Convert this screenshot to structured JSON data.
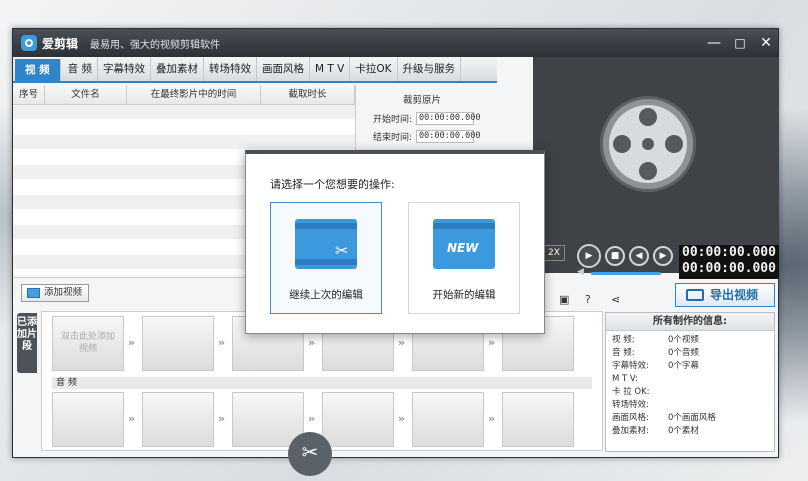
{
  "app": {
    "name": "爱剪辑",
    "slogan": "最易用、强大的视频剪辑软件"
  },
  "window_controls": {
    "minimize": "—",
    "maximize": "□",
    "close": "✕"
  },
  "tabs": [
    "视 频",
    "音 频",
    "字幕特效",
    "叠加素材",
    "转场特效",
    "画面风格",
    "M T V",
    "卡拉OK",
    "升级与服务"
  ],
  "list": {
    "headers": [
      "序号",
      "文件名",
      "在最终影片中的时间",
      "截取时长"
    ]
  },
  "trim": {
    "title": "裁剪原片",
    "start_label": "开始时间:",
    "start_value": "00:00:00.000",
    "end_label": "结束时间:",
    "end_value": "00:00:00.000"
  },
  "player": {
    "speed": "2X",
    "time_current": "00:00:00.000",
    "time_total": "00:00:00.000"
  },
  "add_video_label": "添加视频",
  "export_label": "导出视频",
  "side_tab_label": "已添加片段",
  "timeline": {
    "click_hint": "双击此处添加视频",
    "audio_label": "音 频"
  },
  "info": {
    "title": "所有制作的信息:",
    "rows": [
      {
        "key": "视    频:",
        "value": "0个视频"
      },
      {
        "key": "音    频:",
        "value": "0个音频"
      },
      {
        "key": "字幕特效:",
        "value": "0个字幕"
      },
      {
        "key": "M  T  V:",
        "value": ""
      },
      {
        "key": "卡 拉 OK:",
        "value": ""
      },
      {
        "key": "转场特效:",
        "value": ""
      },
      {
        "key": "画面风格:",
        "value": "0个画面风格"
      },
      {
        "key": "叠加素材:",
        "value": "0个素材"
      }
    ]
  },
  "dialog": {
    "title": "请选择一个您想要的操作:",
    "option1": "继续上次的编辑",
    "option2": "开始新的编辑",
    "new_tag": "NEW"
  },
  "colors": {
    "accent": "#2f85c9",
    "title_bar": "#2d3136"
  }
}
